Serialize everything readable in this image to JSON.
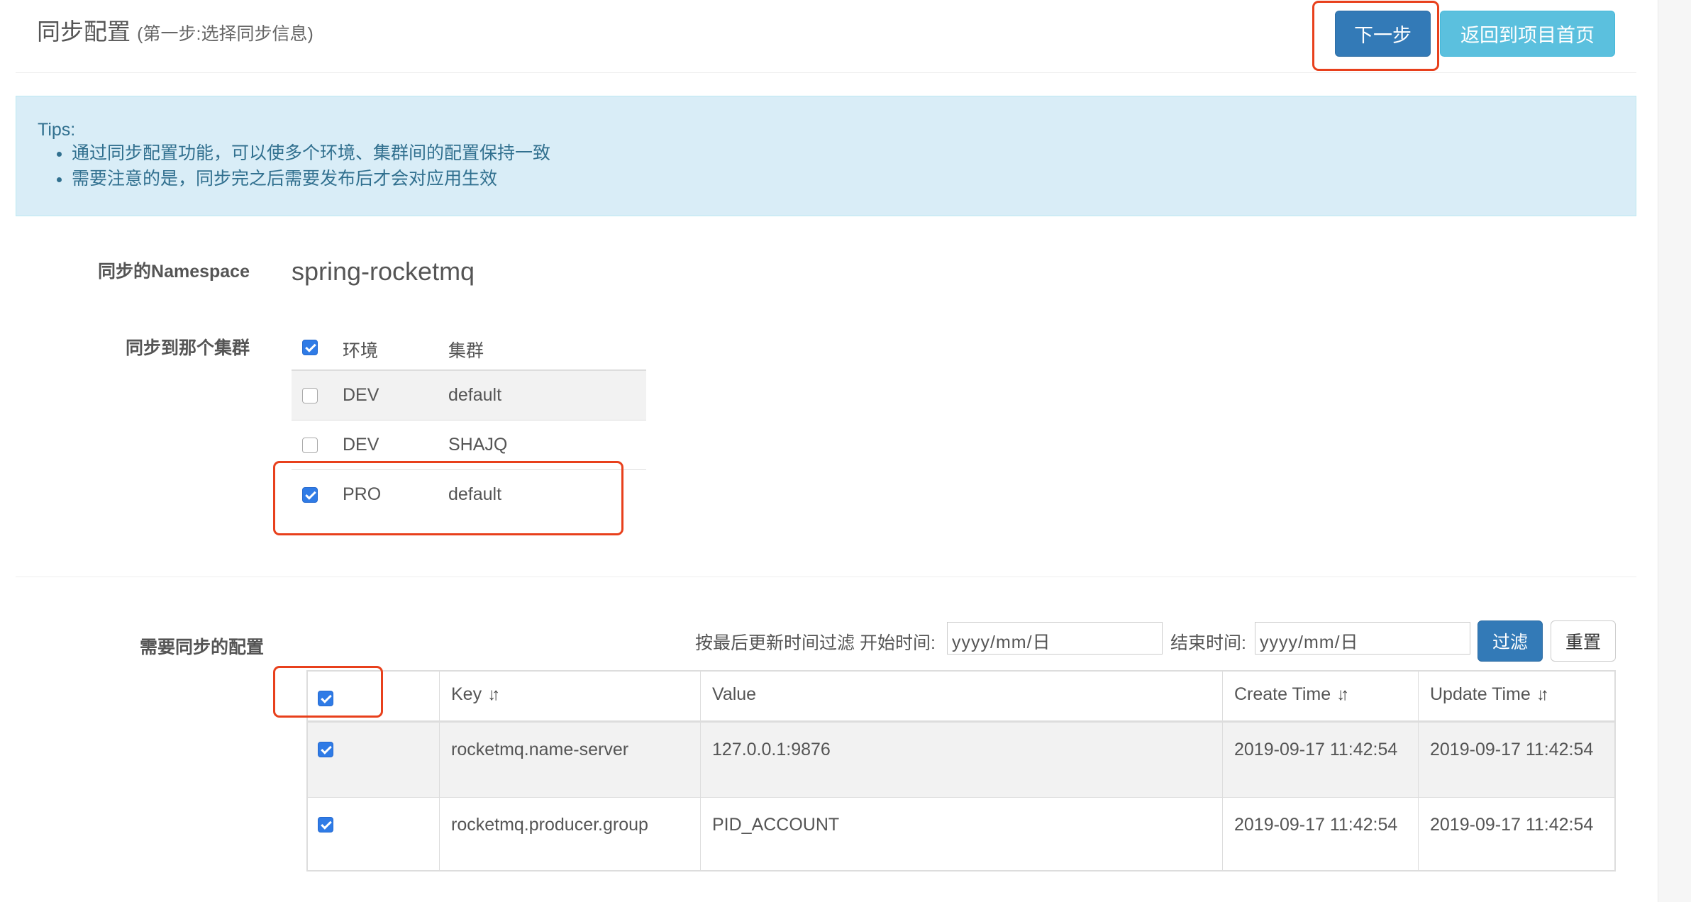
{
  "header": {
    "title": "同步配置",
    "subtitle": "(第一步:选择同步信息)",
    "next_label": "下一步",
    "back_label": "返回到项目首页"
  },
  "tips": {
    "title": "Tips:",
    "items": [
      "通过同步配置功能，可以使多个环境、集群间的配置保持一致",
      "需要注意的是，同步完之后需要发布后才会对应用生效"
    ]
  },
  "namespace": {
    "label": "同步的Namespace",
    "value": "spring-rocketmq"
  },
  "clusters": {
    "label": "同步到那个集群",
    "headers": {
      "env": "环境",
      "cluster": "集群"
    },
    "header_checked": true,
    "rows": [
      {
        "env": "DEV",
        "cluster": "default",
        "checked": false
      },
      {
        "env": "DEV",
        "cluster": "SHAJQ",
        "checked": false
      },
      {
        "env": "PRO",
        "cluster": "default",
        "checked": true
      }
    ]
  },
  "configs": {
    "label": "需要同步的配置",
    "filter": {
      "label": "按最后更新时间过滤",
      "start_label": "开始时间:",
      "start_placeholder": "yyyy/mm/日",
      "end_label": "结束时间:",
      "end_placeholder": "yyyy/mm/日",
      "filter_label": "过滤",
      "reset_label": "重置"
    },
    "columns": [
      "Key",
      "Value",
      "Create Time",
      "Update Time"
    ],
    "header_checked": true,
    "rows": [
      {
        "checked": true,
        "key": "rocketmq.name-server",
        "value": "127.0.0.1:9876",
        "create_time": "2019-09-17 11:42:54",
        "update_time": "2019-09-17 11:42:54"
      },
      {
        "checked": true,
        "key": "rocketmq.producer.group",
        "value": "PID_ACCOUNT",
        "create_time": "2019-09-17 11:42:54",
        "update_time": "2019-09-17 11:42:54"
      }
    ]
  },
  "colors": {
    "primary": "#337ab7",
    "info": "#5bc0de",
    "highlight": "#e8401c",
    "tips_bg": "#d9edf7",
    "tips_text": "#31708f",
    "checkbox": "#2f7be6"
  }
}
